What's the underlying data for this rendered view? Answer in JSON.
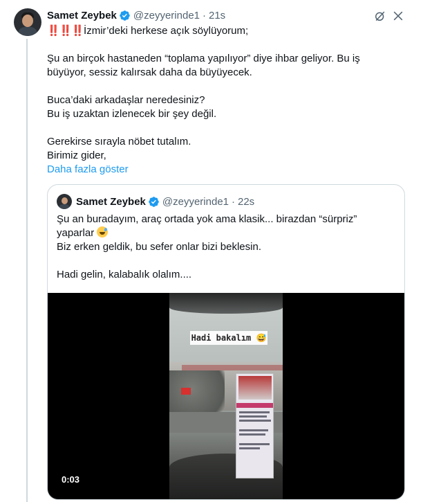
{
  "tweet": {
    "author_name": "Samet Zeybek",
    "handle": "@zeyyerinde1",
    "separator": "·",
    "time": "21s",
    "lines": [
      "İzmir’deki herkese açık söylüyorum;",
      "Şu an birçok hastaneden “toplama yapılıyor” diye ihbar geliyor. Bu iş",
      "büyüyor, sessiz kalırsak daha da büyüyecek.",
      "Buca’daki arkadaşlar neredesiniz?",
      "Bu iş uzaktan izlenecek bir şey değil.",
      "Gerekirse sırayla nöbet tutalım.",
      "Birimiz gider,"
    ],
    "prefix_emoji": "‼️‼️‼️",
    "show_more": "Daha fazla göster"
  },
  "quoted": {
    "author_name": "Samet Zeybek",
    "handle": "@zeyyerinde1",
    "separator": "·",
    "time": "22s",
    "lines": [
      "Şu an buradayım, araç ortada yok ama klasik... birazdan “sürpriz”",
      "yaparlar",
      "Biz erken geldik, bu sefer onlar bizi beklesin.",
      "Hadi gelin, kalabalık olalım...."
    ],
    "video": {
      "overlay_text": "Hadi bakalım 😅",
      "duration": "0:03"
    }
  },
  "icons": {
    "verified": "verified-badge-icon",
    "grok": "grok-icon",
    "more": "more-icon"
  },
  "colors": {
    "link": "#1d9bf0",
    "secondary_text": "#536471",
    "verified": "#1d9bf0",
    "border": "#cfd9de"
  }
}
